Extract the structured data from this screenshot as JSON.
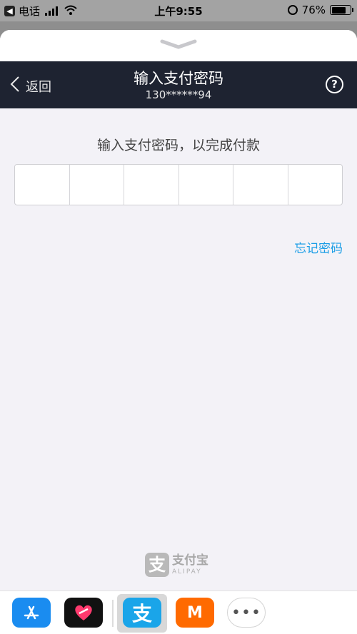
{
  "status_bar": {
    "carrier": "电话",
    "time": "上午9:55",
    "battery_percent_text": "76%",
    "battery_level": 0.76
  },
  "nav": {
    "back_label": "返回",
    "title": "输入支付密码",
    "subtitle": "130******94",
    "help_label": "?"
  },
  "main": {
    "prompt": "输入支付密码，以完成付款",
    "pin_length": 6,
    "forgot_label": "忘记密码"
  },
  "brand": {
    "logo_char": "支",
    "name": "支付宝",
    "sub": "ALIPAY"
  },
  "dock": {
    "alipay_char": "支",
    "mango_char": "M",
    "more_label": "•••"
  },
  "colors": {
    "nav_bg": "#1e2331",
    "link": "#1c9ee6",
    "alipay_blue": "#1aa5e9"
  }
}
